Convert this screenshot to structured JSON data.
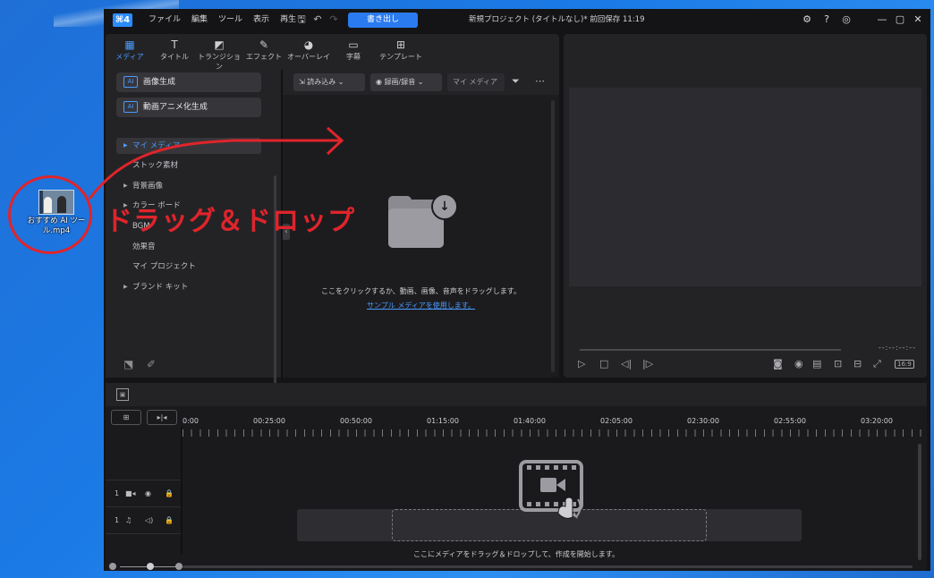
{
  "desktop": {
    "file_icon_label": "おすすめ AI ツール.mp4",
    "annotation": "ドラッグ＆ドロップ"
  },
  "app": {
    "logo": "⌘4",
    "menu": [
      "ファイル",
      "編集",
      "ツール",
      "表示",
      "再生"
    ],
    "export_label": "書き出し",
    "project_title": "新規プロジェクト (タイトルなし)* 前回保存 11:19"
  },
  "tabs": [
    {
      "label": "メディア",
      "icon": "media-icon"
    },
    {
      "label": "タイトル",
      "icon": "title-icon"
    },
    {
      "label": "トランジション",
      "icon": "transition-icon"
    },
    {
      "label": "エフェクト",
      "icon": "effect-icon"
    },
    {
      "label": "オーバーレイ",
      "icon": "overlay-icon"
    },
    {
      "label": "字幕",
      "icon": "subtitle-icon"
    },
    {
      "label": "テンプレート",
      "icon": "template-icon"
    }
  ],
  "sidebar": {
    "ai_buttons": [
      {
        "badge": "AI",
        "label": "画像生成"
      },
      {
        "badge": "AI",
        "label": "動画アニメ化生成"
      }
    ],
    "items": [
      {
        "label": "マイ メディア",
        "caret": "▶"
      },
      {
        "label": "ストック素材",
        "caret": ""
      },
      {
        "label": "背景画像",
        "caret": "▶"
      },
      {
        "label": "カラー ボード",
        "caret": "▶"
      },
      {
        "label": "BGM",
        "caret": ""
      },
      {
        "label": "効果音",
        "caret": ""
      },
      {
        "label": "マイ プロジェクト",
        "caret": ""
      },
      {
        "label": "ブランド キット",
        "caret": "▶"
      }
    ]
  },
  "media_toolbar": {
    "import_label": "読み込み",
    "record_label": "録画/録音",
    "search_placeholder": "マイ メディア"
  },
  "media_empty": {
    "hint": "ここをクリックするか、動画、画像、音声をドラッグします。",
    "sample_link": "サンプル メディアを使用します。"
  },
  "preview": {
    "timecode": "--:--:--:--",
    "aspect_ratio": "16:9"
  },
  "timeline": {
    "ticks": [
      "0:00",
      "00:25:00",
      "00:50:00",
      "01:15:00",
      "01:40:00",
      "02:05:00",
      "02:30:00",
      "02:55:00",
      "03:20:00"
    ],
    "tracks": [
      {
        "number": "1",
        "type": "video"
      },
      {
        "number": "1",
        "type": "audio"
      }
    ],
    "hint": "ここにメディアをドラッグ＆ドロップして、作成を開始します。"
  },
  "colors": {
    "accent": "#2b7bf0",
    "annotation_red": "#e0242b"
  }
}
